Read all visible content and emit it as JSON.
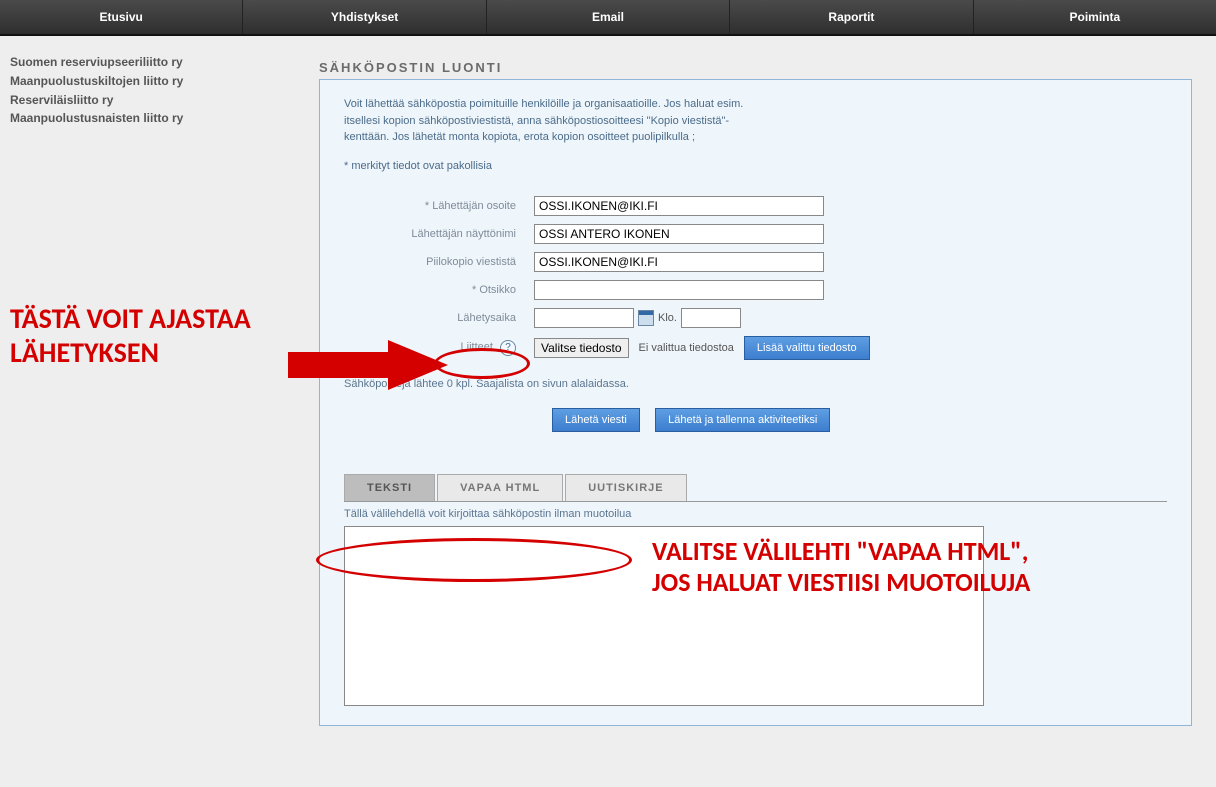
{
  "nav": {
    "items": [
      "Etusivu",
      "Yhdistykset",
      "Email",
      "Raportit",
      "Poiminta"
    ]
  },
  "sidebar": {
    "items": [
      "Suomen reserviupseeriliitto ry",
      "Maanpuolustuskiltojen liitto ry",
      "Reserviläisliitto ry",
      "Maanpuolustusnaisten liitto ry"
    ]
  },
  "page": {
    "title": "SÄHKÖPOSTIN LUONTI",
    "intro_line1": "Voit lähettää sähköpostia poimituille henkilöille ja organisaatioille. Jos haluat esim.",
    "intro_line2": "itsellesi kopion sähköpostiviestistä, anna sähköpostiosoitteesi \"Kopio viestistä\"-",
    "intro_line3": "kenttään. Jos lähetät monta kopiota, erota kopion osoitteet puolipilkulla ;",
    "required_note": "* merkityt tiedot ovat pakollisia"
  },
  "form": {
    "sender_addr_label": "* Lähettäjän osoite",
    "sender_addr_value": "OSSI.IKONEN@IKI.FI",
    "display_name_label": "Lähettäjän näyttönimi",
    "display_name_value": "OSSI ANTERO IKONEN",
    "bcc_label": "Piilokopio viestistä",
    "bcc_value": "OSSI.IKONEN@IKI.FI",
    "subject_label": "* Otsikko",
    "subject_value": "",
    "send_time_label": "Lähetysaika",
    "send_time_date": "",
    "send_time_klo_label": "Klo.",
    "send_time_time": "",
    "attach_label": "Liitteet",
    "choose_file_btn": "Valitse tiedosto",
    "no_file_text": "Ei valittua tiedostoa",
    "add_file_btn": "Lisää valittu tiedosto",
    "count_note": "Sähköposteja lähtee 0 kpl. Saajalista on sivun alalaidassa.",
    "send_btn": "Lähetä viesti",
    "send_save_btn": "Lähetä ja tallenna aktiviteetiksi"
  },
  "editor": {
    "tabs": [
      "TEKSTI",
      "VAPAA HTML",
      "UUTISKIRJE"
    ],
    "active_tab": 0,
    "tab_desc": "Tällä välilehdellä voit kirjoittaa sähköpostin ilman muotoilua",
    "body": ""
  },
  "annotations": {
    "schedule": "TÄSTÄ VOIT AJASTAA LÄHETYKSEN",
    "tabs": "VALITSE VÄLILEHTI \"VAPAA HTML\", JOS HALUAT VIESTIISI MUOTOILUJA"
  }
}
